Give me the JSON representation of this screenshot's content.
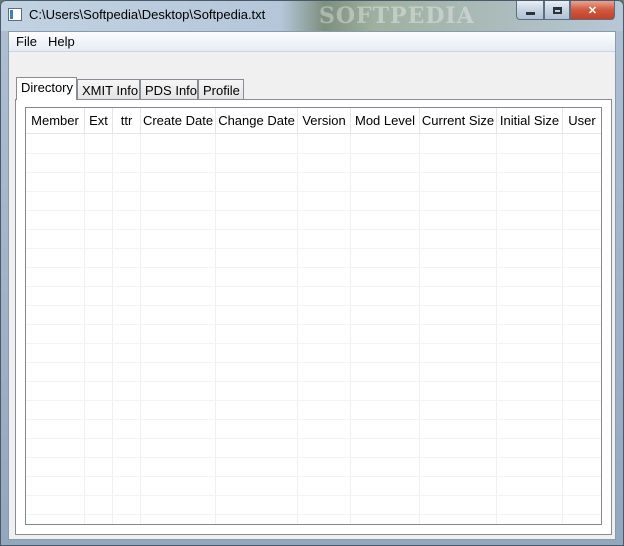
{
  "window": {
    "title": "C:\\Users\\Softpedia\\Desktop\\Softpedia.txt",
    "watermark": "SOFTPEDIA",
    "close_glyph": "✕"
  },
  "menu": {
    "items": [
      "File",
      "Help"
    ]
  },
  "tabs": [
    "Directory",
    "XMIT Info",
    "PDS Info",
    "Profile"
  ],
  "active_tab": "Directory",
  "table": {
    "columns": [
      "Member",
      "Ext",
      "ttr",
      "Create Date",
      "Change Date",
      "Version",
      "Mod Level",
      "Current Size",
      "Initial Size",
      "User"
    ],
    "rows": []
  }
}
